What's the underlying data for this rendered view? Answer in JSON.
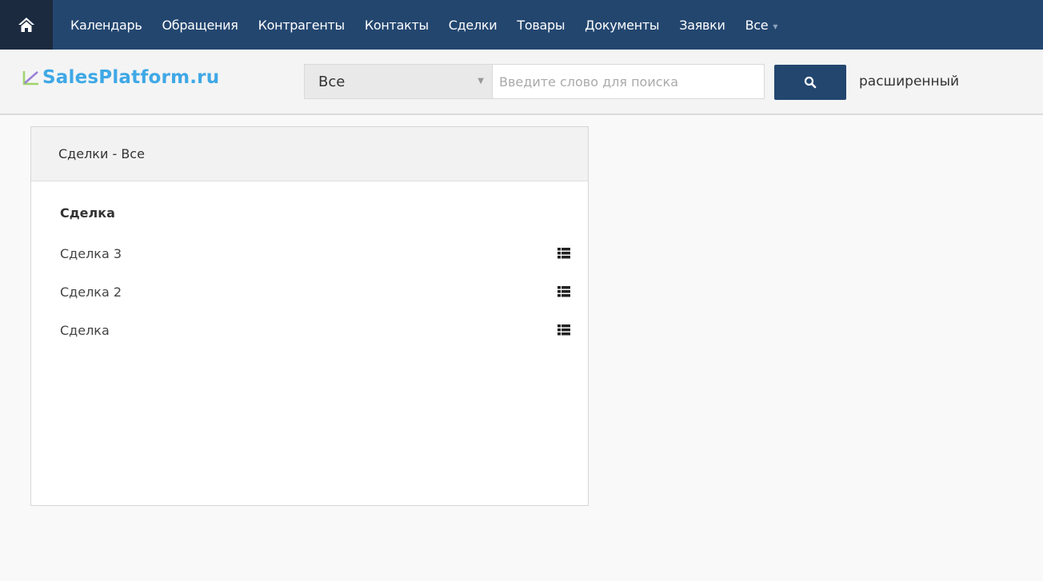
{
  "topnav": {
    "home_icon": "home-icon",
    "items": [
      {
        "label": "Календарь"
      },
      {
        "label": "Обращения"
      },
      {
        "label": "Контрагенты"
      },
      {
        "label": "Контакты"
      },
      {
        "label": "Сделки"
      },
      {
        "label": "Товары"
      },
      {
        "label": "Документы"
      },
      {
        "label": "Заявки"
      },
      {
        "label": "Все"
      }
    ],
    "colors": {
      "bar": "#23466f",
      "home": "#1b2a3f"
    }
  },
  "logo": {
    "text": "SalesPlatform.ru",
    "color": "#3fa8e6"
  },
  "search": {
    "module_selected": "Все",
    "placeholder": "Введите слово для поиска",
    "button_icon": "search-icon",
    "advanced_label": "расширенный"
  },
  "widget": {
    "title": "Сделки - Все",
    "column_header": "Сделка",
    "rows": [
      {
        "label": "Сделка 3",
        "icon": "list-icon"
      },
      {
        "label": "Сделка 2",
        "icon": "list-icon"
      },
      {
        "label": "Сделка",
        "icon": "list-icon"
      }
    ]
  }
}
